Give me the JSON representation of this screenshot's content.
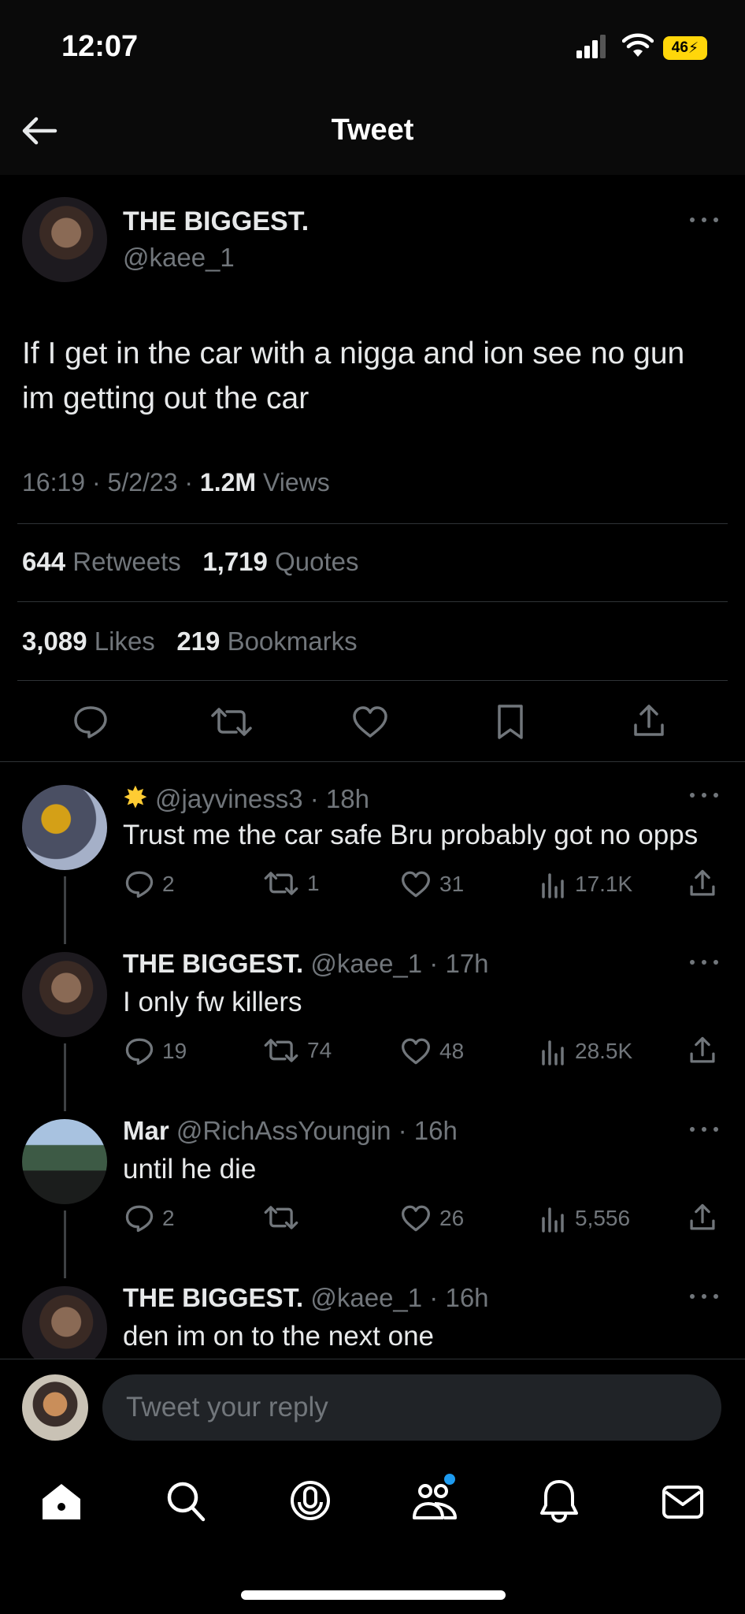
{
  "status_bar": {
    "time": "12:07",
    "battery": "46"
  },
  "header": {
    "title": "Tweet"
  },
  "tweet": {
    "display_name": "THE BIGGEST.",
    "handle": "@kaee_1",
    "text": "If I get in the car with a nigga and ion see no gun im getting out the car",
    "time": "16:19",
    "date": "5/2/23",
    "views_count": "1.2M",
    "views_label": "Views",
    "retweets_count": "644",
    "retweets_label": "Retweets",
    "quotes_count": "1,719",
    "quotes_label": "Quotes",
    "likes_count": "3,089",
    "likes_label": "Likes",
    "bookmarks_count": "219",
    "bookmarks_label": "Bookmarks"
  },
  "replies": [
    {
      "display_name": "",
      "badge": "sparkle-emoji",
      "handle": "@jayviness3",
      "age": "18h",
      "text": "Trust me the car safe Bru probably got no opps",
      "replies": "2",
      "retweets": "1",
      "likes": "31",
      "views": "17.1K"
    },
    {
      "display_name": "THE BIGGEST.",
      "handle": "@kaee_1",
      "age": "17h",
      "text": "I only fw killers",
      "replies": "19",
      "retweets": "74",
      "likes": "48",
      "views": "28.5K"
    },
    {
      "display_name": "Mar",
      "handle": "@RichAssYoungin",
      "age": "16h",
      "text": "until he die",
      "replies": "2",
      "retweets": "",
      "likes": "26",
      "views": "5,556"
    },
    {
      "display_name": "THE BIGGEST.",
      "handle": "@kaee_1",
      "age": "16h",
      "text": "den im on to the next one"
    }
  ],
  "composer": {
    "placeholder": "Tweet your reply"
  },
  "colors": {
    "background": "#000000",
    "text": "#e7e9ea",
    "muted": "#71767b",
    "accent": "#1d9bf0",
    "battery": "#ffd60a"
  }
}
